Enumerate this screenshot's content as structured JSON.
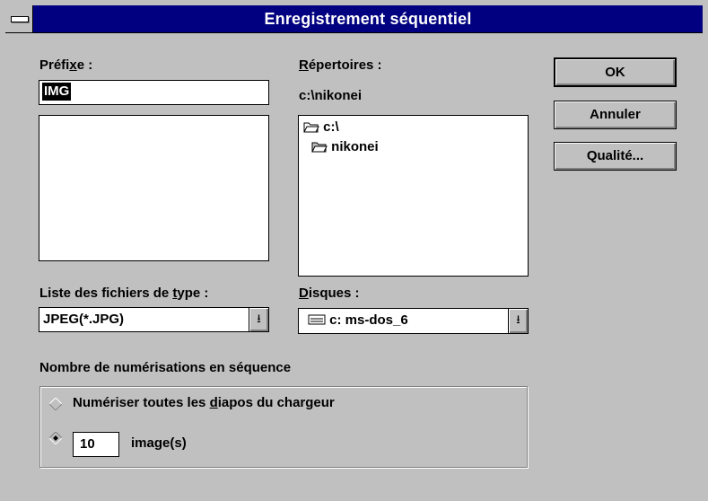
{
  "window": {
    "title": "Enregistrement séquentiel"
  },
  "prefix": {
    "label_pre": "Préfi",
    "label_ul": "x",
    "label_post": "e :",
    "value": "IMG"
  },
  "directories": {
    "label_ul": "R",
    "label_post": "épertoires :",
    "current_path": "c:\\nikonei",
    "tree": [
      {
        "label": "c:\\",
        "icon": "open-folder-icon"
      },
      {
        "label": "nikonei",
        "icon": "open-folder-icon"
      }
    ]
  },
  "file_type": {
    "label_pre": "Liste des fichiers de ",
    "label_ul": "t",
    "label_post": "ype :",
    "value": "JPEG(*.JPG)"
  },
  "drives": {
    "label_ul": "D",
    "label_post": "isques :",
    "value": "c: ms-dos_6",
    "icon": "drive-icon"
  },
  "buttons": {
    "ok": "OK",
    "cancel": "Annuler",
    "quality": "Qualité..."
  },
  "sequence": {
    "group_label": "Nombre de numérisations en séquence",
    "option_all_pre": "Numériser toutes les ",
    "option_all_ul": "d",
    "option_all_post": "iapos du chargeur",
    "option_count_value": "10",
    "option_count_suffix": "image(s)",
    "selected": "count"
  }
}
